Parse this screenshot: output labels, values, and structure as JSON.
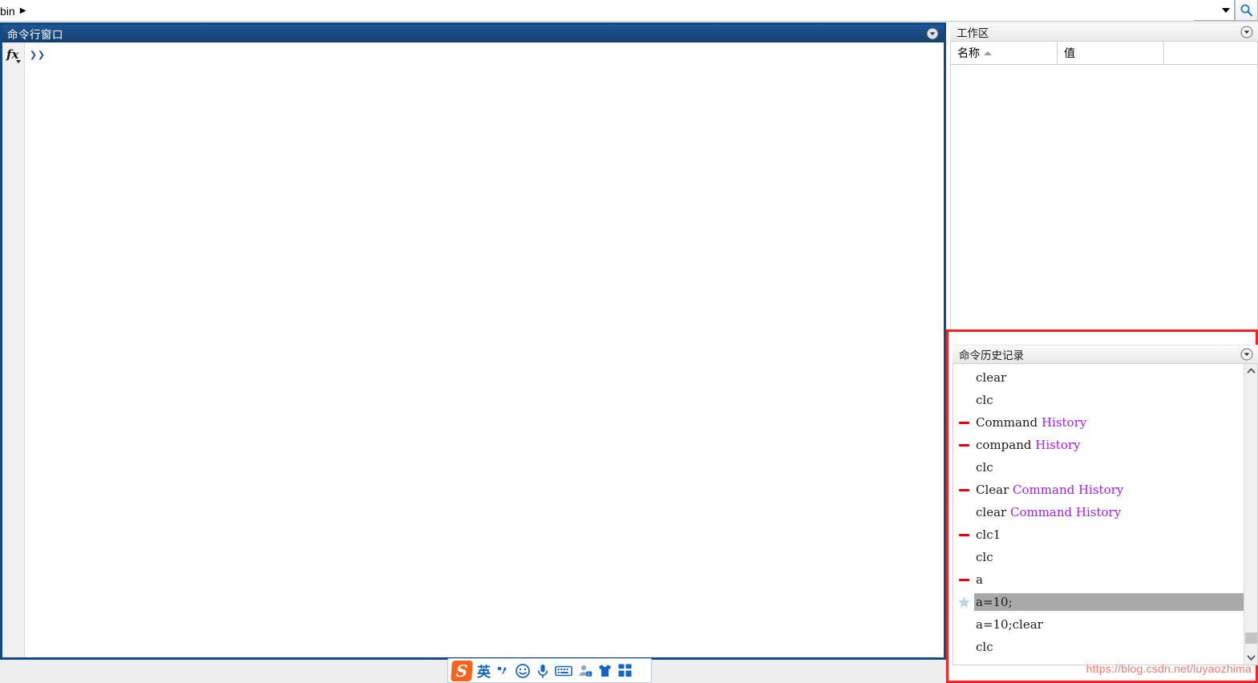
{
  "topbar": {
    "breadcrumb_text": "bin",
    "breadcrumb_arrow": "▶",
    "search_value": "",
    "search_placeholder": "",
    "search_icon": "search-icon"
  },
  "command_window": {
    "title": "命令行窗口",
    "fx_label": "fx",
    "prompt": "❯❯",
    "dropdown_icon": "chevron-down-circle-icon",
    "border_color": "#124a82",
    "titlebar_color": "#1e5595"
  },
  "workspace": {
    "title": "工作区",
    "dropdown_icon": "chevron-down-circle-icon",
    "columns": [
      "名称",
      "值",
      ""
    ],
    "sort_column": "名称",
    "sort_direction": "asc",
    "rows": []
  },
  "command_history": {
    "title": "命令历史记录",
    "dropdown_icon": "chevron-down-circle-icon",
    "highlight_color": "#fe2020",
    "selection_color": "#a9a9a9",
    "error_marker_color": "#e8000a",
    "arg_token_color": "#a020f0",
    "entries": [
      {
        "marker": "none",
        "selected": false,
        "tokens": [
          {
            "text": "clear",
            "type": "main"
          }
        ]
      },
      {
        "marker": "none",
        "selected": false,
        "tokens": [
          {
            "text": "clc",
            "type": "main"
          }
        ]
      },
      {
        "marker": "error",
        "selected": false,
        "tokens": [
          {
            "text": "Command ",
            "type": "main"
          },
          {
            "text": "History",
            "type": "arg"
          }
        ]
      },
      {
        "marker": "error",
        "selected": false,
        "tokens": [
          {
            "text": "compand ",
            "type": "main"
          },
          {
            "text": "History",
            "type": "arg"
          }
        ]
      },
      {
        "marker": "none",
        "selected": false,
        "tokens": [
          {
            "text": "clc",
            "type": "main"
          }
        ]
      },
      {
        "marker": "error",
        "selected": false,
        "tokens": [
          {
            "text": "Clear ",
            "type": "main"
          },
          {
            "text": "Command History",
            "type": "arg"
          }
        ]
      },
      {
        "marker": "none",
        "selected": false,
        "tokens": [
          {
            "text": "clear ",
            "type": "main"
          },
          {
            "text": "Command History",
            "type": "arg"
          }
        ]
      },
      {
        "marker": "error",
        "selected": false,
        "tokens": [
          {
            "text": "clc1",
            "type": "main"
          }
        ]
      },
      {
        "marker": "none",
        "selected": false,
        "tokens": [
          {
            "text": "clc",
            "type": "main"
          }
        ]
      },
      {
        "marker": "error",
        "selected": false,
        "tokens": [
          {
            "text": "a",
            "type": "main"
          }
        ]
      },
      {
        "marker": "star",
        "selected": true,
        "tokens": [
          {
            "text": "a=10;",
            "type": "main"
          }
        ]
      },
      {
        "marker": "none",
        "selected": false,
        "tokens": [
          {
            "text": "a=10;clear",
            "type": "main"
          }
        ]
      },
      {
        "marker": "none",
        "selected": false,
        "tokens": [
          {
            "text": "clc",
            "type": "main"
          }
        ]
      }
    ],
    "scrollbar": {
      "up_icon": "chevron-up-icon",
      "down_icon": "chevron-down-icon"
    }
  },
  "ime_toolbar": {
    "logo_text": "S",
    "mode_label": "英",
    "items": [
      "sogou-logo",
      "input-mode-english",
      "punctuation-icon",
      "emoji-icon",
      "microphone-icon",
      "soft-keyboard-icon",
      "user-icon",
      "skin-icon",
      "apps-grid-icon"
    ]
  },
  "watermark": {
    "text": "https://blog.csdn.net/luyaozhima"
  }
}
